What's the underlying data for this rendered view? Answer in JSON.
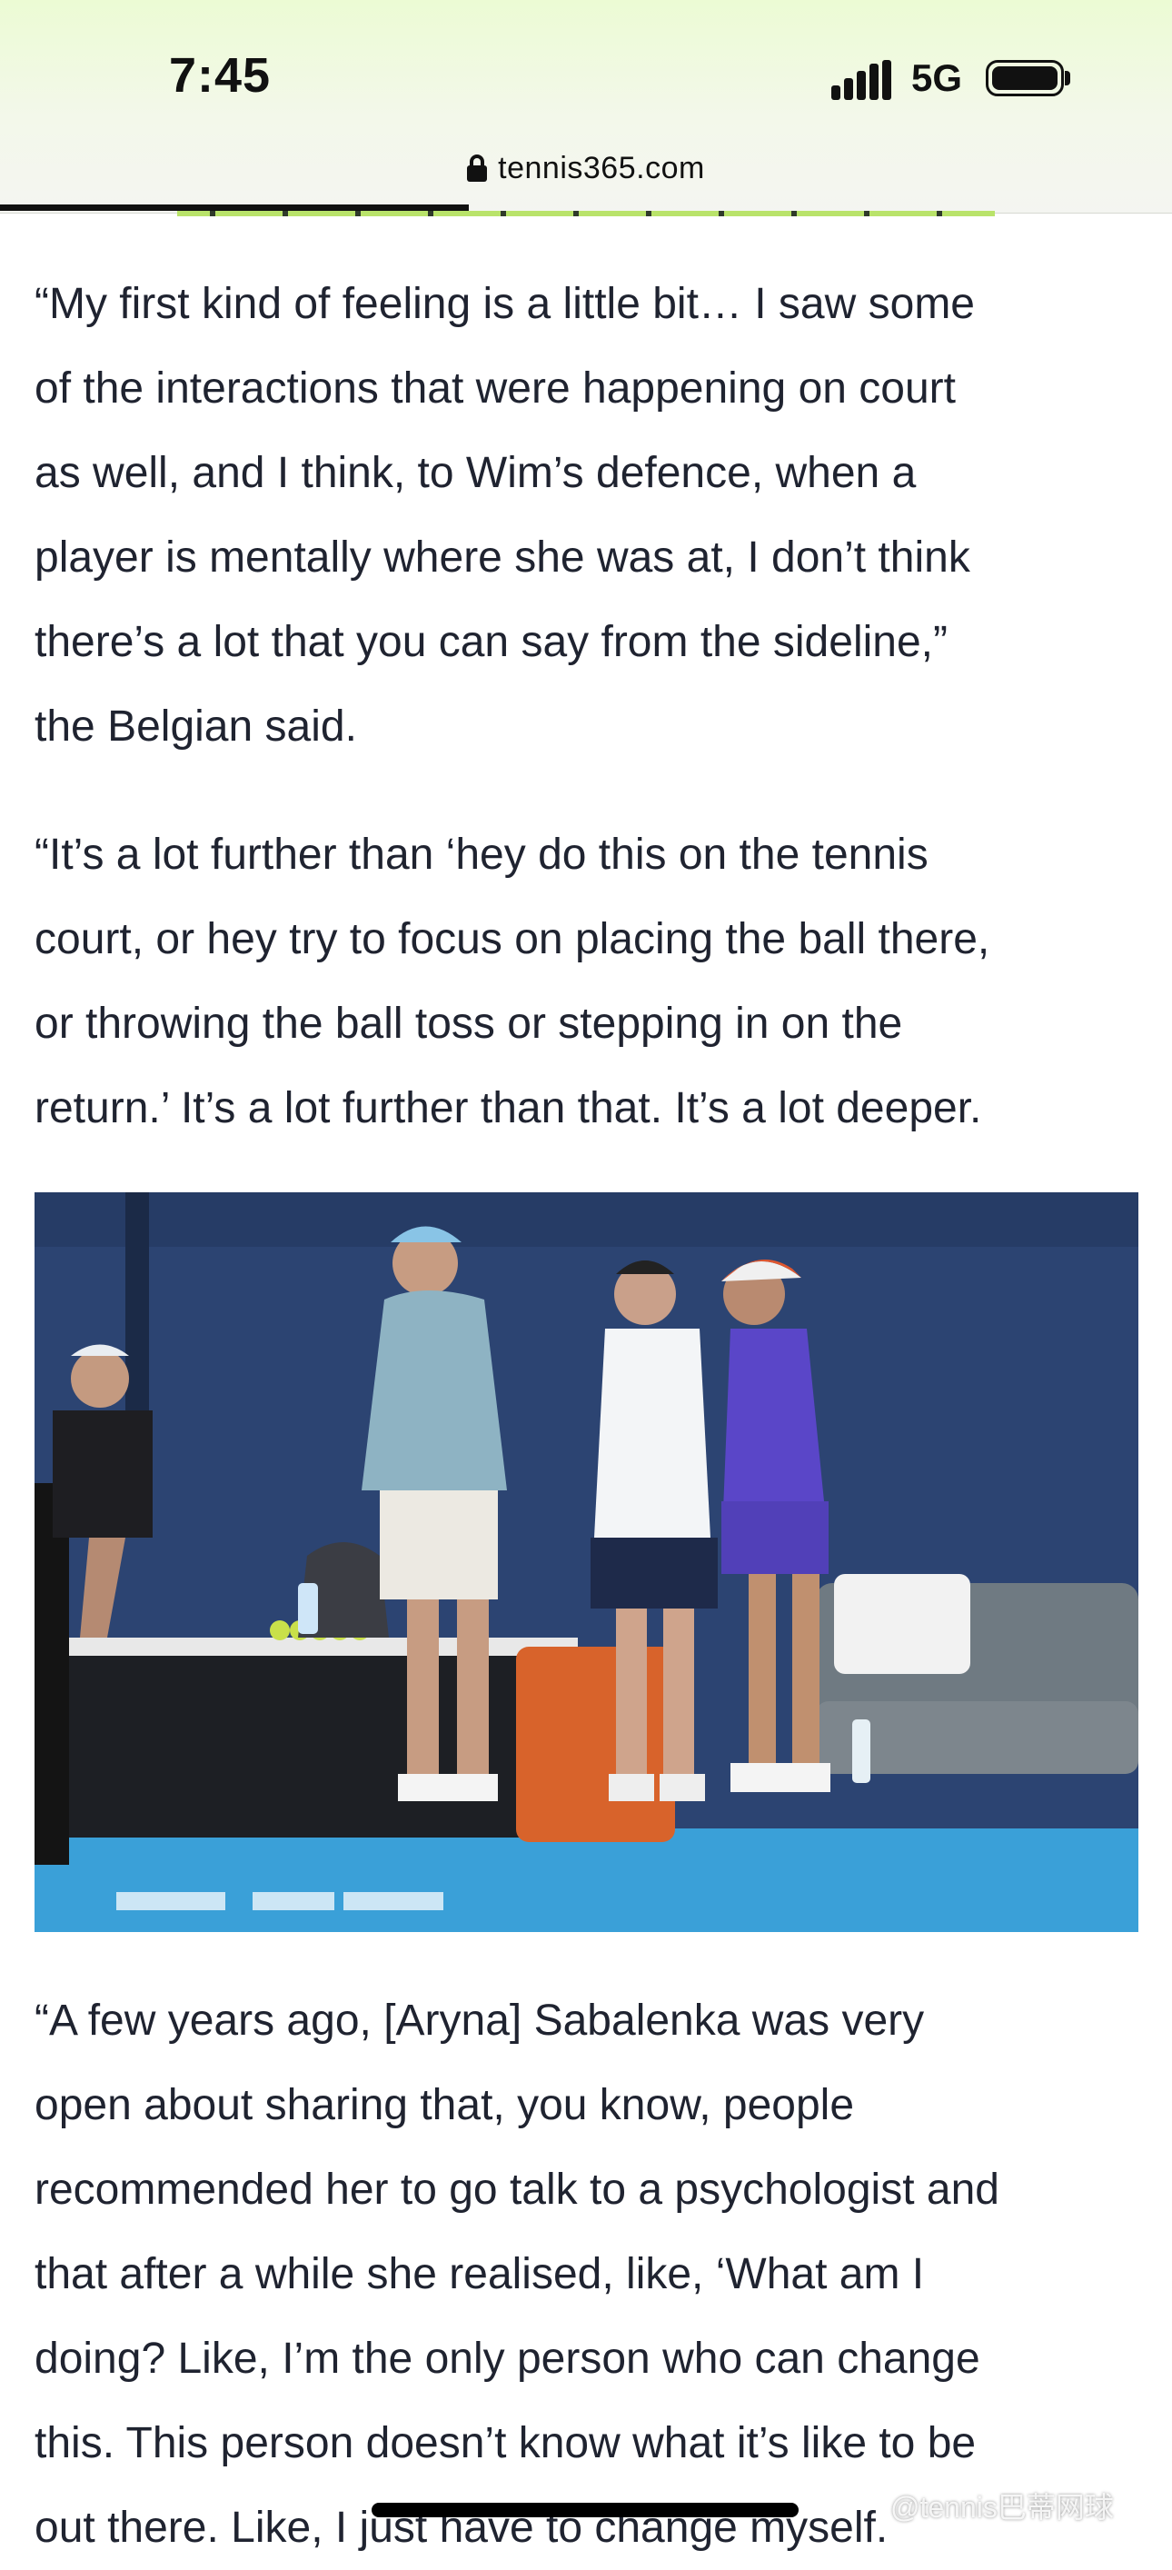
{
  "status_bar": {
    "time": "7:45",
    "network": "5G"
  },
  "browser": {
    "url": "tennis365.com",
    "load_progress": 0.4
  },
  "article": {
    "paragraph_1": [
      "“My first kind of feeling is a little bit… I saw some",
      "of the interactions that were happening on court",
      "as well, and I think, to Wim’s defence, when a",
      "player is mentally where she was at, I don’t think",
      "there’s a lot that you can say from the sideline,”",
      "the Belgian said."
    ],
    "paragraph_2": [
      "“It’s a lot further than ‘hey do this on the tennis",
      "court, or hey try to focus on placing the ball there,",
      "or throwing the ball toss or stepping in on the",
      "return.’ It’s a lot further than that. It’s a lot deeper."
    ],
    "paragraph_3": [
      "“A few years ago, [Aryna] Sabalenka was very",
      "open about sharing that, you know, people",
      "recommended her to go talk to a psychologist and",
      "that after a while she realised, like, ‘What am I",
      "doing? Like, I’m the only person who can change",
      "this. This person doesn’t know what it’s like to be",
      "out there. Like, I just have to change myself."
    ]
  },
  "watermark": "@tennis巴蒂网球",
  "icons": {
    "lock": "lock-icon",
    "signal": "cellular-signal-icon",
    "battery": "battery-icon"
  },
  "colors": {
    "court_blue": "#2c4472",
    "court_floor": "#3aa0d8",
    "player_shirt": "#5a46c8"
  }
}
